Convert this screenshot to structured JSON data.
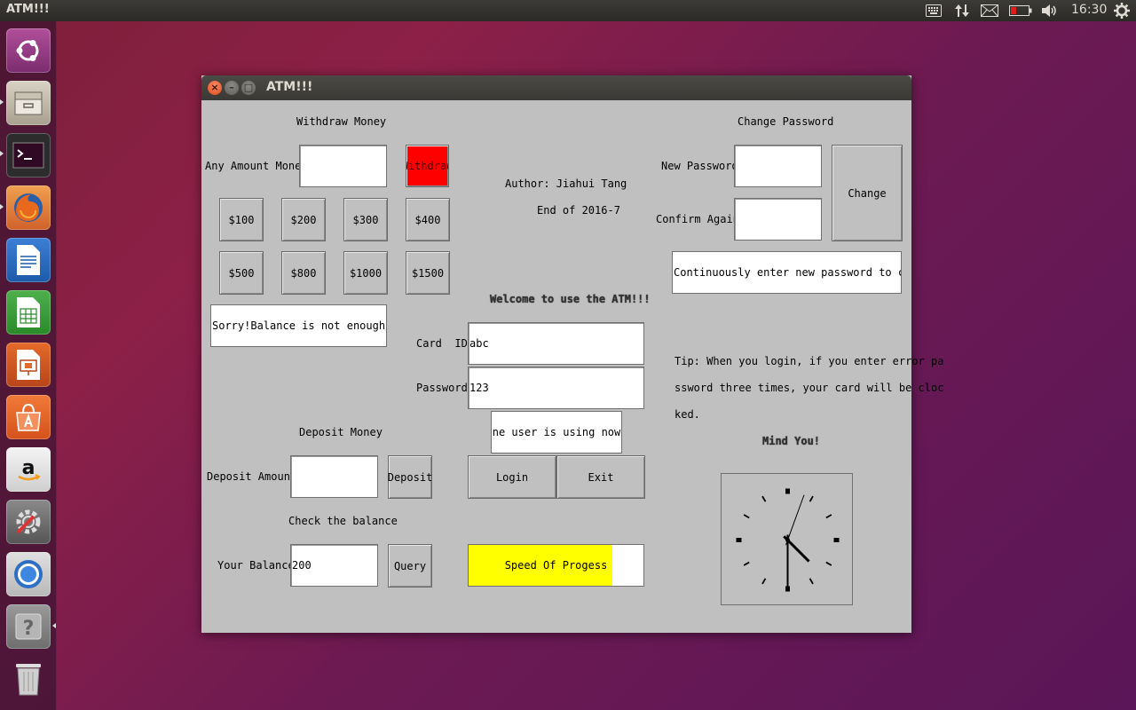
{
  "top_panel": {
    "app_title": "ATM!!!",
    "clock": "16:30",
    "icons": [
      "keyboard-icon",
      "network-arrows-icon",
      "mail-icon",
      "battery-icon",
      "volume-icon",
      "settings-gear-icon"
    ]
  },
  "launcher": {
    "items": [
      "ubuntu-dash-icon",
      "files-icon",
      "terminal-icon",
      "firefox-icon",
      "writer-icon",
      "calc-icon",
      "impress-icon",
      "software-center-icon",
      "amazon-icon",
      "system-settings-icon",
      "chromium-icon",
      "help-icon",
      "trash-icon"
    ]
  },
  "window": {
    "title": "ATM!!!",
    "withdraw": {
      "title": "Withdraw Money",
      "any_amount_label": "Any Amount Money:",
      "any_amount_value": "",
      "withdraw_button": "Withdraw",
      "amounts": [
        "$100",
        "$200",
        "$300",
        "$400",
        "$500",
        "$800",
        "$1000",
        "$1500"
      ],
      "message": "Sorry!Balance is not enough!"
    },
    "author": {
      "line1": "Author: Jiahui Tang",
      "line2": "End of 2016-7"
    },
    "login": {
      "welcome": "Welcome to use the ATM!!!",
      "card_id_label": "Card  ID:",
      "card_id_value": "abc",
      "password_label": "Password:",
      "password_value": "123",
      "status": "One user is using now!",
      "login_button": "Login",
      "exit_button": "Exit"
    },
    "change_password": {
      "title": "Change Password",
      "new_label": "New Password:",
      "new_value": "",
      "confirm_label": "Confirm Again:",
      "confirm_value": "",
      "change_button": "Change",
      "message": "Continuously enter new password to change"
    },
    "tip": {
      "line1": "Tip: When you login, if you enter error pa",
      "line2": "ssword three times, your card will be cloc",
      "line3": "ked.",
      "mind": "Mind You!"
    },
    "deposit": {
      "title": "Deposit Money",
      "amount_label": "Deposit Amount:",
      "amount_value": "",
      "button": "Deposit"
    },
    "balance": {
      "title": "Check the balance",
      "label": "Your Balance:",
      "value": "200",
      "button": "Query"
    },
    "progress": {
      "label": "Speed Of Progess",
      "fraction": 0.82,
      "color": "#ffff00"
    },
    "analog_clock": {
      "hour": 4,
      "minute": 30
    }
  }
}
